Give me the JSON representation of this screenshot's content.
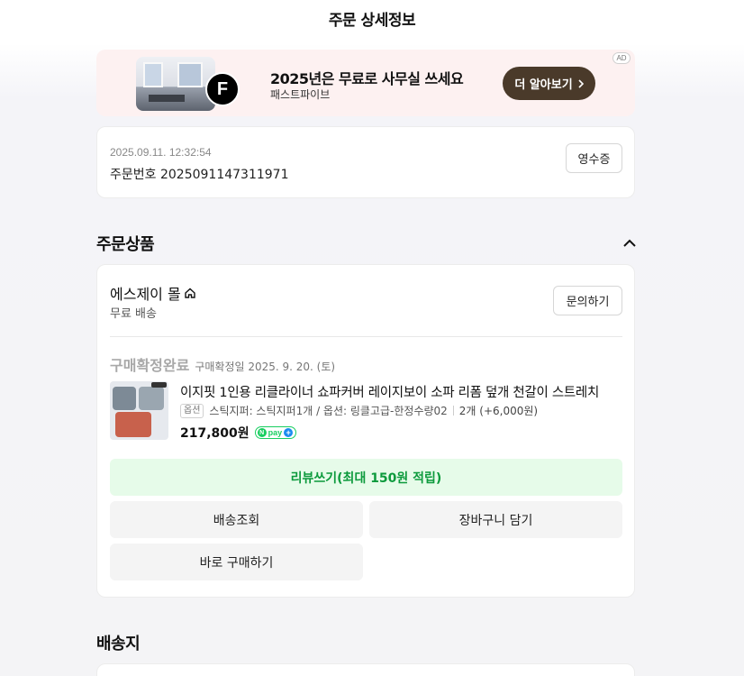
{
  "page": {
    "title": "주문 상세정보"
  },
  "ad": {
    "headline": "2025년은 무료로 사무실 쓰세요",
    "advertiser": "패스트파이브",
    "logo_letter": "F",
    "cta_label": "더 알아보기",
    "cta_icon": "chevron-right-icon",
    "badge": "AD"
  },
  "order": {
    "datetime": "2025.09.11. 12:32:54",
    "number_text": "주문번호 2025091147311971",
    "receipt_label": "영수증"
  },
  "products_section": {
    "title": "주문상품",
    "toggle_icon": "chevron-up-icon",
    "store": {
      "name": "에스제이 몰",
      "icon": "home-icon",
      "shipping_fee": "무료 배송",
      "inquiry_label": "문의하기"
    },
    "item": {
      "status": "구매확정완료",
      "confirm_date": "구매확정일 2025. 9. 20. (토)",
      "name": "이지핏 1인용 리클라이너 쇼파커버 레이지보이 소파 리폼 덮개 천갈이 스트레치",
      "option_badge": "옵션",
      "option_text": "스틱지퍼: 스틱지퍼1개 / 옵션: 링클고급-한정수량02",
      "quantity_text": "2개 (+6,000원)",
      "price": "217,800원",
      "pay_badge": "pay"
    },
    "buttons": {
      "review": "리뷰쓰기(최대 150원 적립)",
      "track": "배송조회",
      "cart": "장바구니 담기",
      "buy_again": "바로 구매하기"
    }
  },
  "shipping_section": {
    "title": "배송지"
  },
  "colors": {
    "review_bg": "#e6fbe9",
    "review_text": "#0c9a3c",
    "ad_bg": "#fdf1f1",
    "ad_cta_bg": "#4a3a2a",
    "npay_green": "#19ce60"
  }
}
